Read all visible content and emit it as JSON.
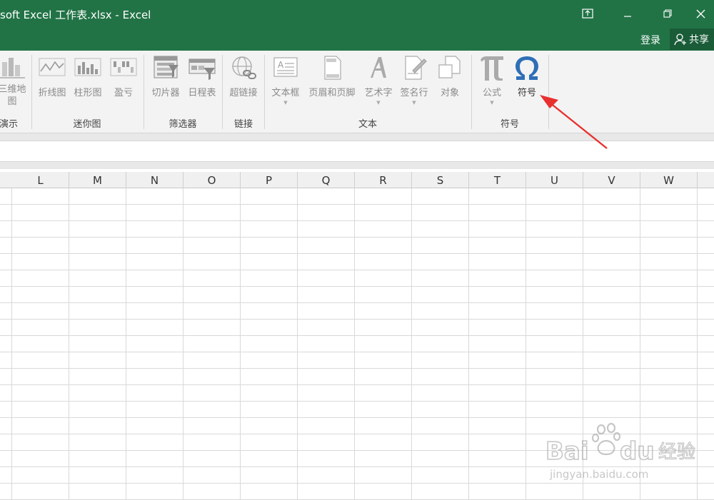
{
  "window": {
    "title": "soft Excel 工作表.xlsx - Excel",
    "login": "登录",
    "share": "共享"
  },
  "ribbon": {
    "groups": {
      "demo": "演示",
      "sparklines": "迷你图",
      "filters": "筛选器",
      "links": "链接",
      "text": "文本",
      "symbols": "符号"
    },
    "buttons": {
      "map3d_line1": "三维地",
      "map3d_line2": "图",
      "line": "折线图",
      "column": "柱形图",
      "winloss": "盈亏",
      "slicer": "切片器",
      "timeline": "日程表",
      "hyperlink": "超链接",
      "textbox": "文本框",
      "header_footer": "页眉和页脚",
      "wordart": "艺术字",
      "signature": "签名行",
      "object": "对象",
      "equation": "公式",
      "symbol": "符号"
    }
  },
  "sheet": {
    "columns": [
      "L",
      "M",
      "N",
      "O",
      "P",
      "Q",
      "R",
      "S",
      "T",
      "U",
      "V",
      "W"
    ]
  },
  "watermark": {
    "brand": "Bai du 经验",
    "url": "jingyan.baidu.com"
  },
  "colors": {
    "excel_green": "#217346",
    "symbol_blue": "#2e6fb7",
    "arrow_red": "#e8302e"
  }
}
